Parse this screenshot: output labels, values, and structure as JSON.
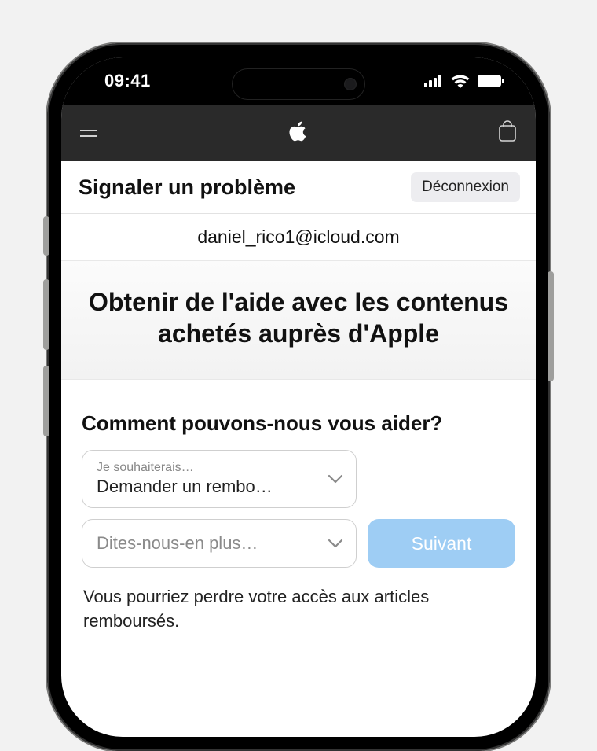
{
  "status": {
    "time": "09:41"
  },
  "page": {
    "title": "Signaler un problème",
    "logout": "Déconnexion",
    "email": "daniel_rico1@icloud.com",
    "hero": "Obtenir de l'aide avec les contenus achetés auprès d'Apple"
  },
  "form": {
    "heading": "Comment pouvons-nous vous aider?",
    "select1": {
      "label": "Je souhaiterais…",
      "value": "Demander un rembo…"
    },
    "select2": {
      "placeholder": "Dites-nous-en plus…"
    },
    "nextLabel": "Suivant",
    "disclaimer": "Vous pourriez perdre votre accès aux articles remboursés."
  }
}
